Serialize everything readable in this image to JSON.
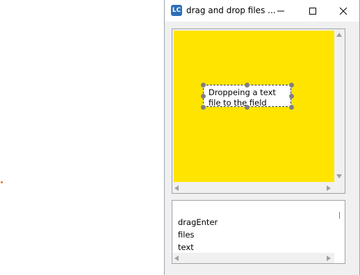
{
  "window": {
    "title": "drag and drop files ...",
    "app_icon_text": "LC",
    "controls": {
      "minimize": "minimize",
      "maximize": "maximize",
      "close": "close"
    }
  },
  "drop_area": {
    "background_color": "#ffe400",
    "text_field": {
      "text": "Droppeing a text file to the field"
    }
  },
  "log": {
    "lines": [
      "dragEnter",
      "files",
      "text"
    ]
  }
}
